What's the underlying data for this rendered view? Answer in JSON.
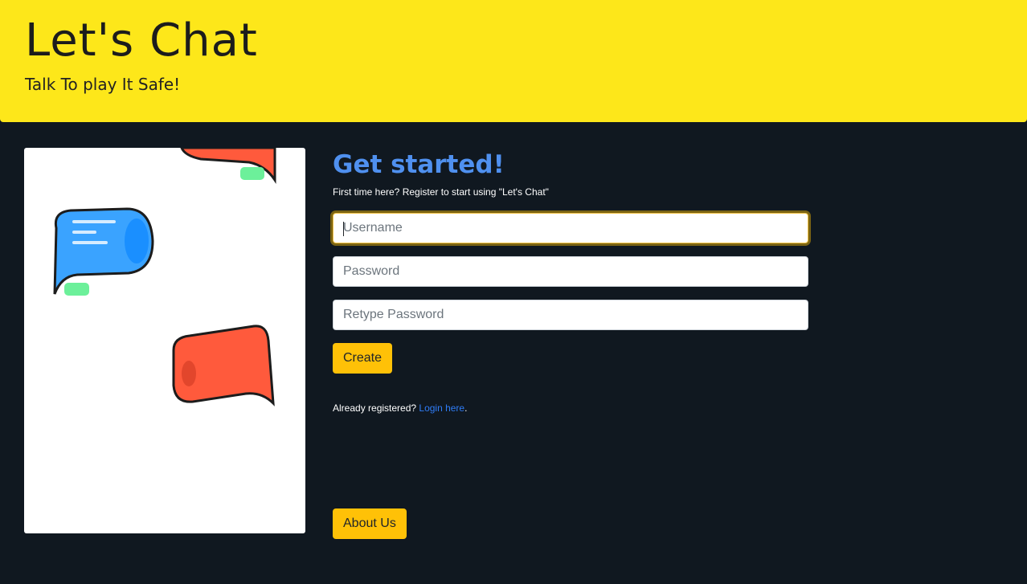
{
  "header": {
    "title": "Let's Chat",
    "tagline": "Talk To play It Safe!",
    "background": "#fde71a"
  },
  "illustration": {
    "description_icon": "chat-bubbles-illustration"
  },
  "signup": {
    "heading": "Get started!",
    "intro": "First time here? Register to start using \"Let's Chat\"",
    "username_placeholder": "Username",
    "username_value": "",
    "password_placeholder": "Password",
    "password_value": "",
    "retype_placeholder": "Retype Password",
    "retype_value": "",
    "create_label": "Create",
    "already_text": "Already registered? ",
    "login_link": "Login here",
    "login_suffix": ".",
    "about_label": "About Us"
  },
  "colors": {
    "page_background": "#101820",
    "accent_button": "#ffc107",
    "heading_blue": "#4f90ef",
    "link_blue": "#2f7cf6"
  }
}
